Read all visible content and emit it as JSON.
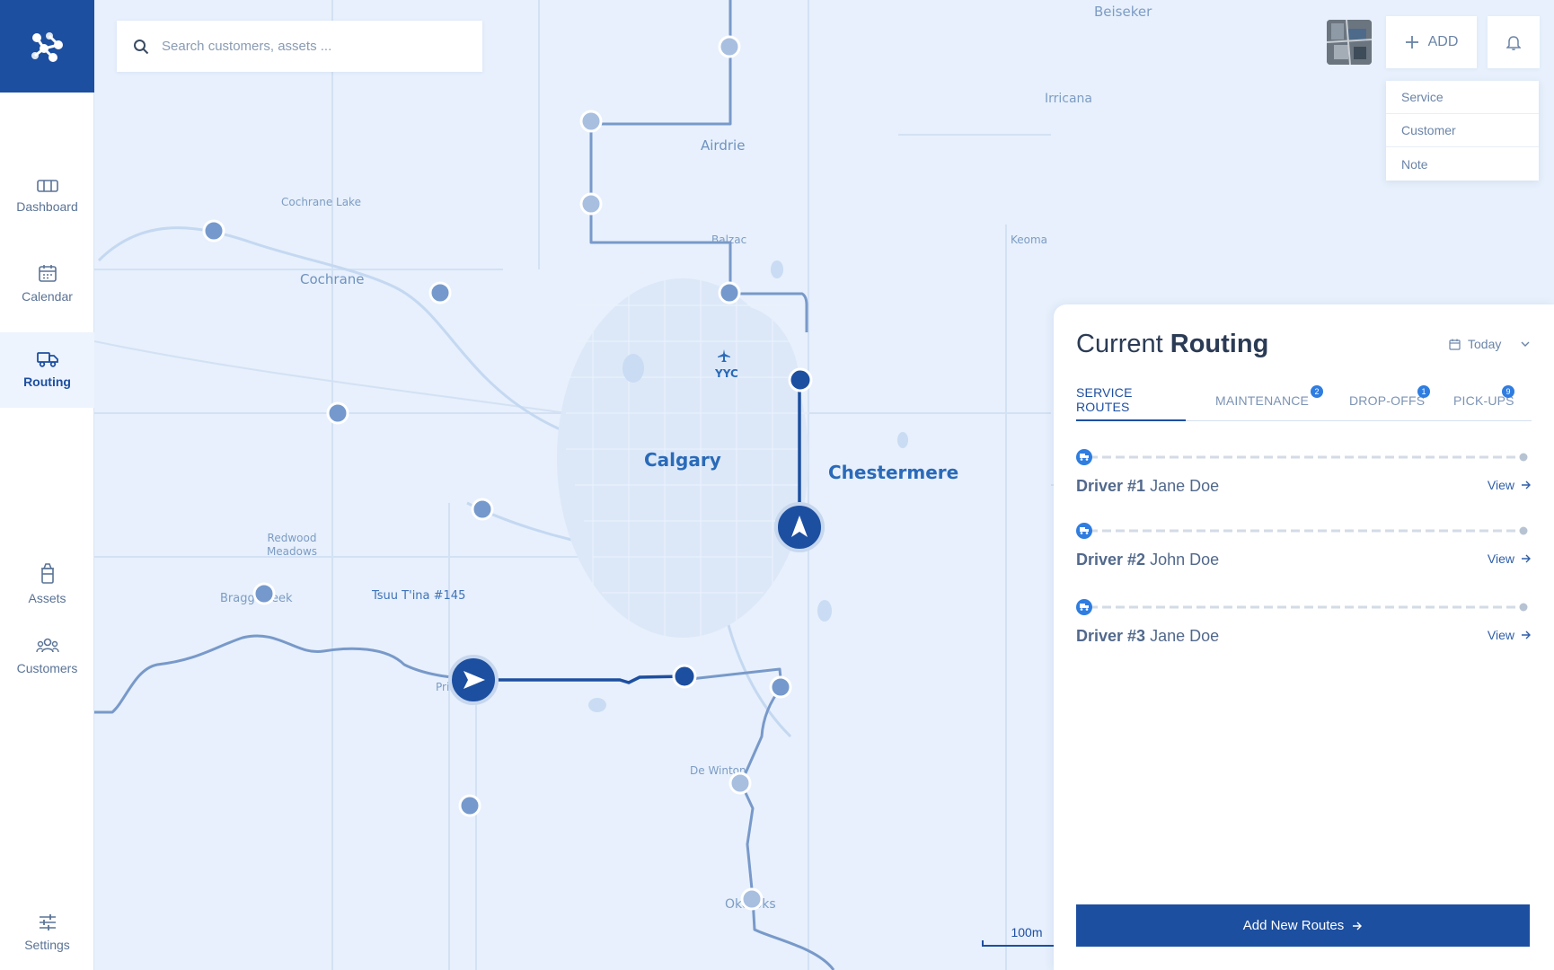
{
  "sidebar": {
    "items": [
      {
        "label": "Dashboard",
        "icon": "dashboard-icon"
      },
      {
        "label": "Calendar",
        "icon": "calendar-icon"
      },
      {
        "label": "Routing",
        "icon": "truck-icon",
        "active": true
      },
      {
        "label": "Assets",
        "icon": "trash-bin-icon"
      },
      {
        "label": "Customers",
        "icon": "people-icon"
      },
      {
        "label": "Settings",
        "icon": "sliders-icon"
      }
    ]
  },
  "search": {
    "placeholder": "Search customers, assets ..."
  },
  "header": {
    "add_label": "ADD",
    "add_menu": [
      "Service",
      "Customer",
      "Note"
    ]
  },
  "map": {
    "places": [
      "Beiseker",
      "Irricana",
      "Airdrie",
      "Cochrane Lake",
      "Cochrane",
      "Balzac",
      "Keoma",
      "YYC",
      "Calgary",
      "Chestermere",
      "Redwood Meadows",
      "Bragg Creek",
      "Tsuu T'ina #145",
      "De Winton",
      "Okotoks",
      "Priddis"
    ],
    "scale_label": "100m",
    "zoom_in": "+",
    "zoom_out": "−"
  },
  "routing": {
    "title_light": "Current",
    "title_bold": "Routing",
    "date": "Today",
    "tabs": [
      {
        "label": "SERVICE ROUTES",
        "active": true
      },
      {
        "label": "MAINTENANCE",
        "badge": "2"
      },
      {
        "label": "DROP-OFFS",
        "badge": "1"
      },
      {
        "label": "PICK-UPS",
        "badge": "9"
      }
    ],
    "drivers": [
      {
        "number": "Driver #1",
        "name": "Jane Doe",
        "view": "View"
      },
      {
        "number": "Driver #2",
        "name": "John Doe",
        "view": "View"
      },
      {
        "number": "Driver #3",
        "name": "Jane Doe",
        "view": "View"
      }
    ],
    "cta": "Add New Routes"
  },
  "colors": {
    "brand": "#1d4fa0",
    "accent": "#2f7de0",
    "map_bg": "#e7f0fc"
  }
}
